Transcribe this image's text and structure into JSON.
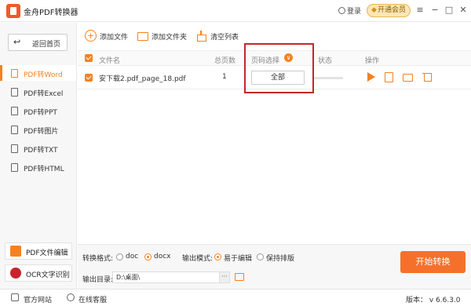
{
  "app": {
    "title": "金舟PDF转换器"
  },
  "titlebar": {
    "login_label": "登录",
    "vip_label": "开通会员",
    "menu_glyph": "≡",
    "minimize_glyph": "−",
    "maximize_glyph": "□",
    "close_glyph": "✕"
  },
  "sidebar": {
    "home_label": "返回首页",
    "items": [
      {
        "label": "PDF转Word",
        "active": true
      },
      {
        "label": "PDF转Excel"
      },
      {
        "label": "PDF转PPT"
      },
      {
        "label": "PDF转图片"
      },
      {
        "label": "PDF转TXT"
      },
      {
        "label": "PDF转HTML"
      }
    ],
    "tools": [
      {
        "label": "PDF文件编辑",
        "color": "#f5821f"
      },
      {
        "label": "OCR文字识别",
        "color": "#c8232c"
      }
    ]
  },
  "toolbar": {
    "add_file": "添加文件",
    "add_folder": "添加文件夹",
    "clear_list": "清空列表"
  },
  "table": {
    "headers": {
      "filename": "文件名",
      "total_pages": "总页数",
      "page_select": "页码选择",
      "status": "状态",
      "actions": "操作"
    },
    "rows": [
      {
        "filename": "安下载2.pdf_page_18.pdf",
        "total_pages": "1",
        "page_select": "全部",
        "checked": true
      }
    ]
  },
  "bottom": {
    "format_label": "转换格式:",
    "formats": [
      {
        "label": "doc",
        "selected": false
      },
      {
        "label": "docx",
        "selected": true
      }
    ],
    "mode_label": "输出模式:",
    "modes": [
      {
        "label": "易于编辑",
        "selected": true
      },
      {
        "label": "保持排版",
        "selected": false
      }
    ],
    "dir_label": "输出目录:",
    "dir_value": "D:\\桌面\\",
    "browse_label": "···",
    "start_label": "开始转换"
  },
  "statusbar": {
    "website": "官方网站",
    "support": "在线客服",
    "version": "版本： v 6.6.3.0"
  },
  "colors": {
    "accent": "#f5821f",
    "highlight": "#c0282d"
  }
}
